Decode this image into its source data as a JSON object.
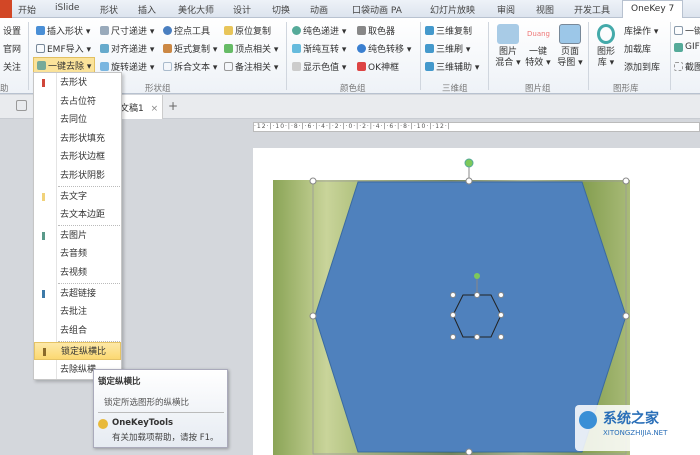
{
  "tabs": [
    "开始",
    "iSlide",
    "形状",
    "插入",
    "美化大师",
    "设计",
    "切换",
    "动画",
    "口袋动画 PA",
    "幻灯片放映",
    "审阅",
    "视图",
    "开发工具",
    "OneKey 7"
  ],
  "ribbon": {
    "left_col": [
      "设置",
      "官网",
      "关注"
    ],
    "left_group": "助",
    "shape": {
      "col1": [
        "插入形状 ▾",
        "EMF导入 ▾",
        "一键去除 ▾"
      ],
      "col2": [
        "尺寸递进 ▾",
        "对齐递进 ▾",
        "旋转递进 ▾"
      ],
      "col3": [
        "控点工具",
        "矩式复制 ▾",
        "拆合文本 ▾"
      ],
      "col4": [
        "原位复制",
        "顶点相关 ▾",
        "备注相关 ▾"
      ],
      "label": "形状组"
    },
    "color": {
      "col1": [
        "纯色递进 ▾",
        "渐纯互转 ▾",
        "显示色值 ▾"
      ],
      "col2": [
        "取色器",
        "纯色转移 ▾",
        "OK神框"
      ],
      "label": "颜色组"
    },
    "threed": {
      "items": [
        "三维复制",
        "三维刷 ▾",
        "三维辅助 ▾"
      ],
      "label": "三维组"
    },
    "picture": {
      "items": [
        "图片\n混合 ▾",
        "一键\n特效 ▾",
        "页面\n导图 ▾"
      ],
      "label": "图片组",
      "duang": "Duang"
    },
    "lib": {
      "big": "图形\n库 ▾",
      "items": [
        "库操作 ▾",
        "加载库",
        "添加到库"
      ],
      "label": "图形库"
    },
    "extra": [
      "一键",
      "GIF",
      "截图"
    ]
  },
  "doctab": {
    "name": "文稿1",
    "close": "×",
    "add": "+"
  },
  "ruler": "·12·|·10·|·8·|·6·|·4·|·2·|·0·|·2·|·4·|·6·|·8·|·10·|·12·|",
  "menu": {
    "items": [
      "去形状",
      "去占位符",
      "去同位",
      "去形状填充",
      "去形状边框",
      "去形状阴影",
      "去文字",
      "去文本边距",
      "去图片",
      "去音频",
      "去视频",
      "去超链接",
      "去批注",
      "去组合",
      "锁定纵横比",
      "去除纵横"
    ],
    "highlighted": 14
  },
  "tooltip": {
    "title": "锁定纵横比",
    "desc": "锁定所选图形的纵横比",
    "brand": "OneKeyTools",
    "help": "有关加载项帮助，请按 F1。"
  },
  "watermark": {
    "cn": "系统之家",
    "en": "XITONGZHIJIA.NET"
  },
  "colors": {
    "hexagon": "#4f81bd",
    "accent": "#f6d16a"
  }
}
